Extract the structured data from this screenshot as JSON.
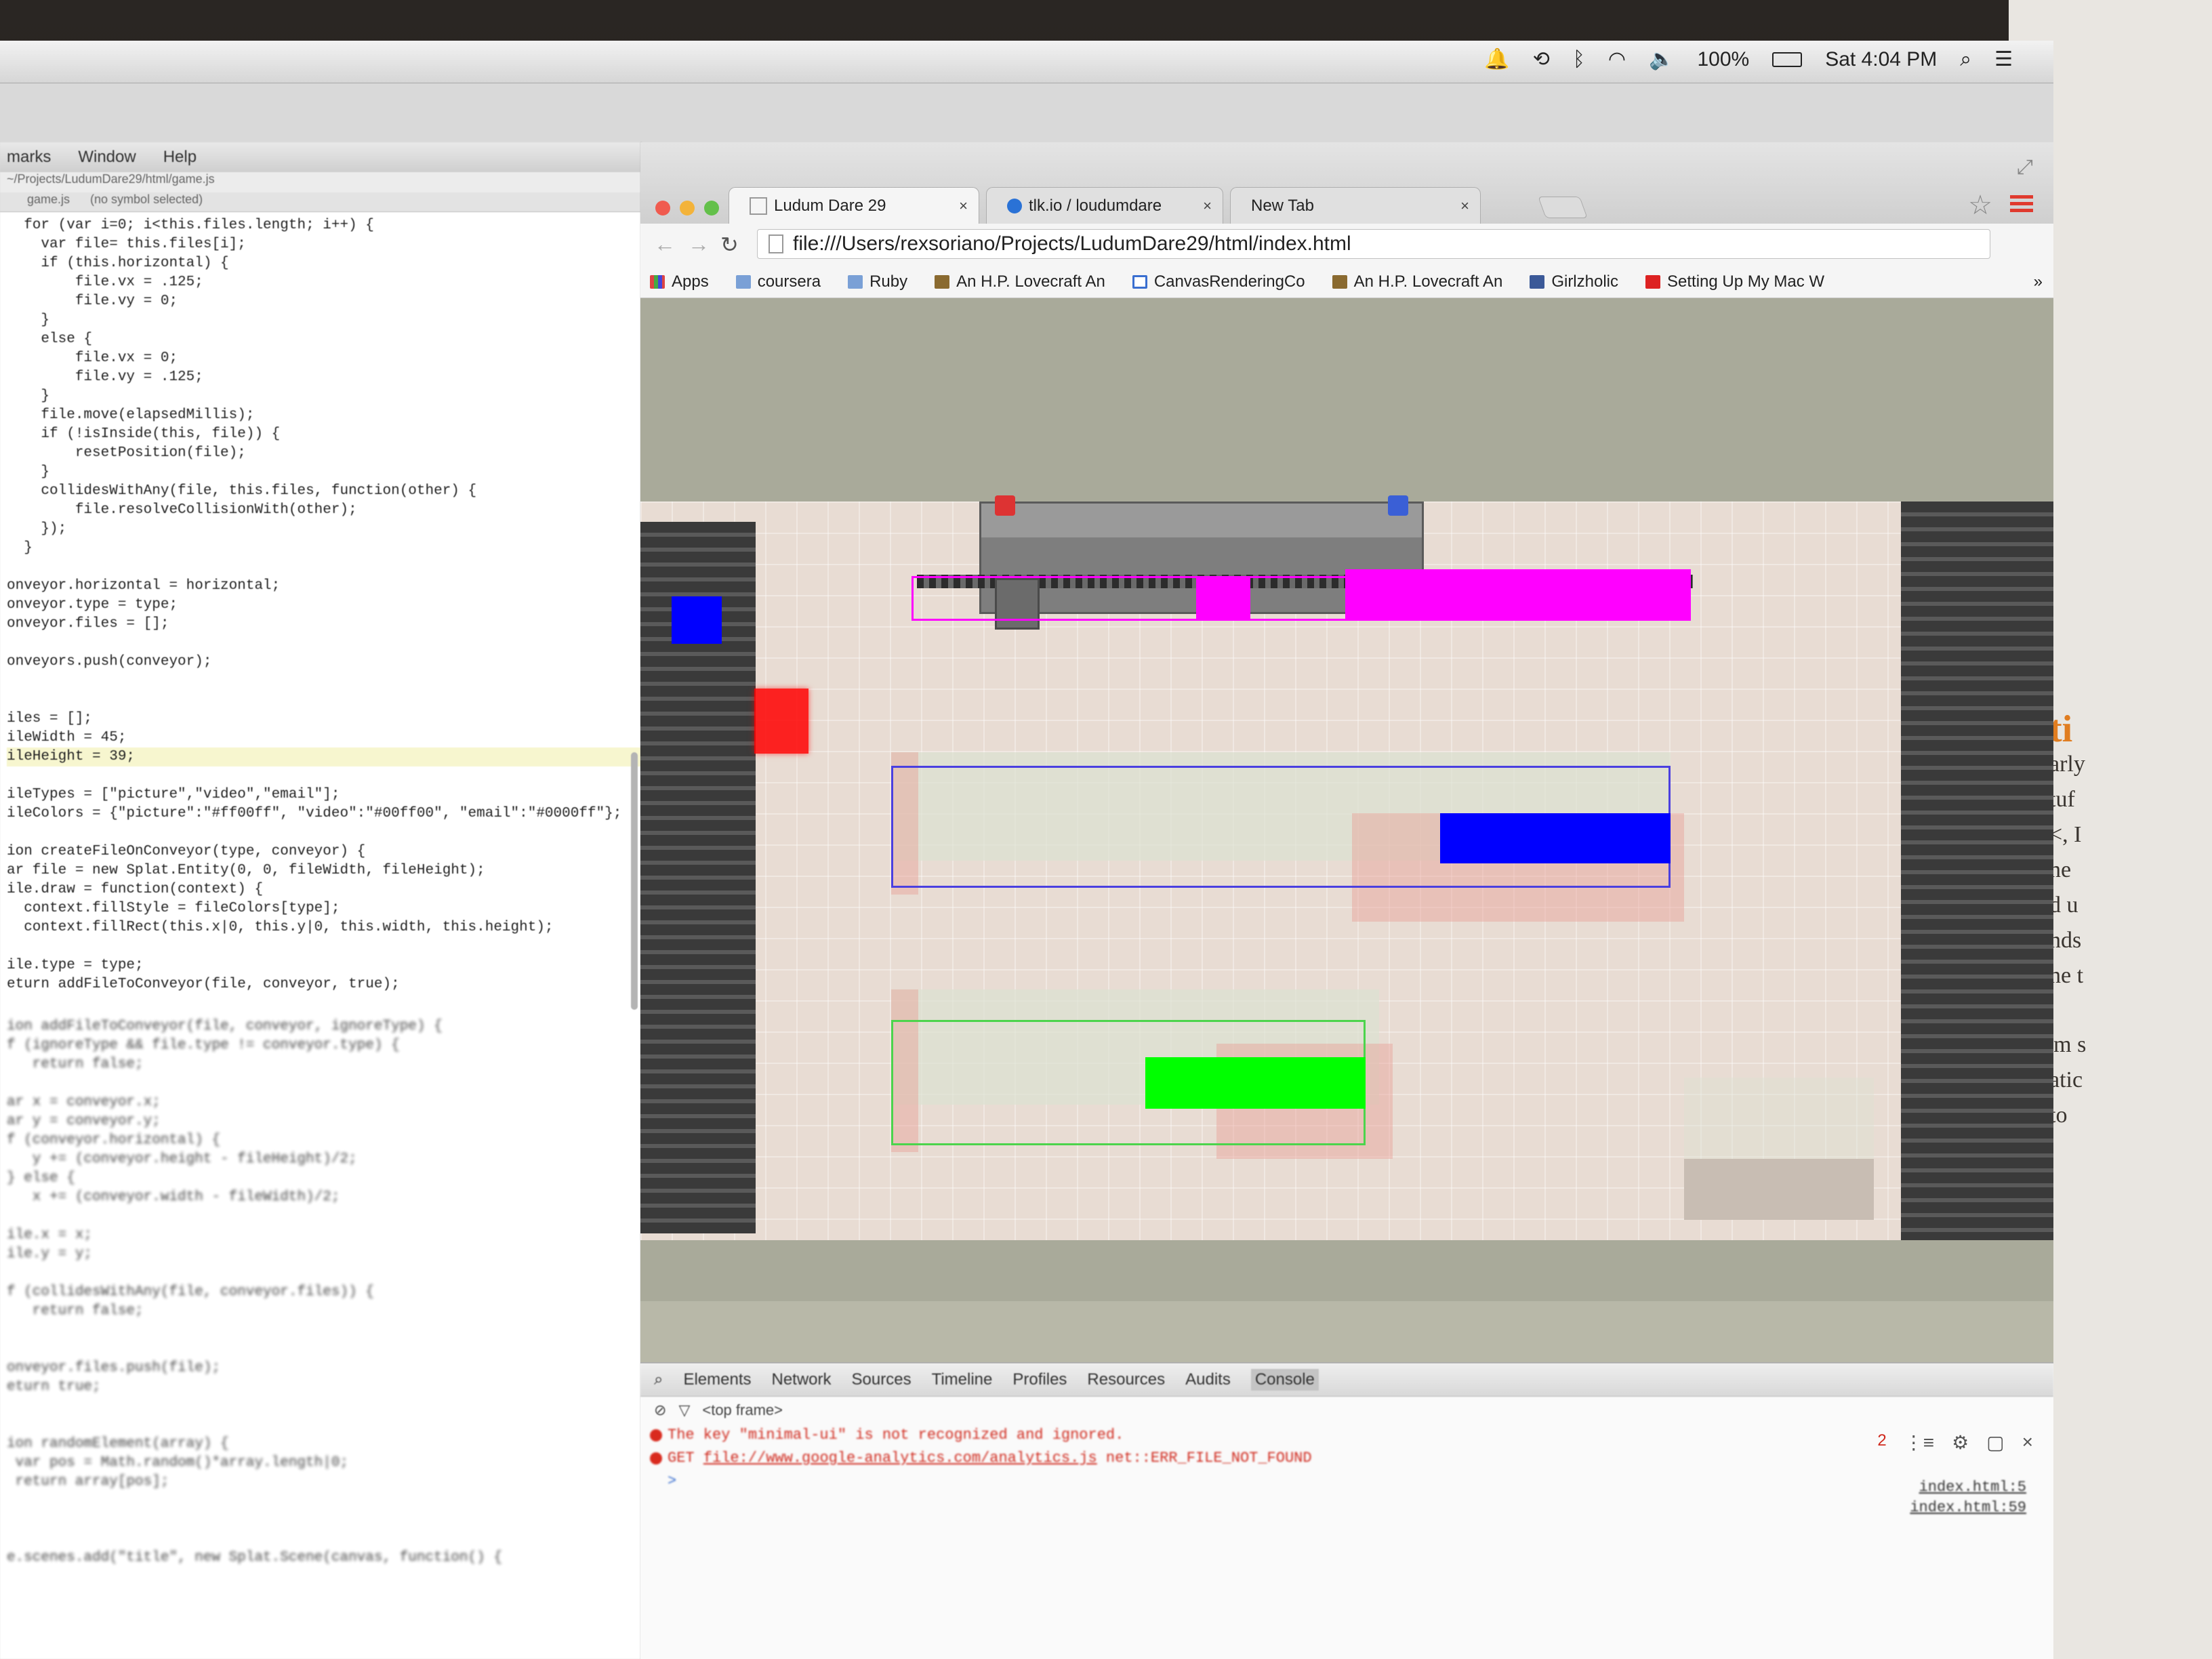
{
  "menubar": {
    "battery": "100%",
    "clock": "Sat 4:04 PM"
  },
  "editor": {
    "menu": [
      "marks",
      "Window",
      "Help"
    ],
    "path": "~/Projects/LudumDare29/html/game.js",
    "tab_file": "game.js",
    "symbol": "(no symbol selected)",
    "code_sharp": [
      "  for (var i=0; i<this.files.length; i++) {",
      "    var file= this.files[i];",
      "    if (this.horizontal) {",
      "        file.vx = .125;",
      "        file.vy = 0;",
      "    }",
      "    else {",
      "        file.vx = 0;",
      "        file.vy = .125;",
      "    }",
      "    file.move(elapsedMillis);",
      "    if (!isInside(this, file)) {",
      "        resetPosition(file);",
      "    }",
      "    collidesWithAny(file, this.files, function(other) {",
      "        file.resolveCollisionWith(other);",
      "    });",
      "  }",
      "",
      "onveyor.horizontal = horizontal;",
      "onveyor.type = type;",
      "onveyor.files = [];",
      "",
      "onveyors.push(conveyor);",
      "",
      "",
      "iles = [];",
      "ileWidth = 45;",
      "ileHeight = 39;",
      "",
      "ileTypes = [\"picture\",\"video\",\"email\"];",
      "ileColors = {\"picture\":\"#ff00ff\", \"video\":\"#00ff00\", \"email\":\"#0000ff\"};",
      "",
      "ion createFileOnConveyor(type, conveyor) {",
      "ar file = new Splat.Entity(0, 0, fileWidth, fileHeight);",
      "ile.draw = function(context) {",
      "  context.fillStyle = fileColors[type];",
      "  context.fillRect(this.x|0, this.y|0, this.width, this.height);",
      "",
      "ile.type = type;",
      "eturn addFileToConveyor(file, conveyor, true);"
    ],
    "code_blur": [
      "",
      "ion addFileToConveyor(file, conveyor, ignoreType) {",
      "f (ignoreType && file.type != conveyor.type) {",
      "   return false;",
      "",
      "ar x = conveyor.x;",
      "ar y = conveyor.y;",
      "f (conveyor.horizontal) {",
      "   y += (conveyor.height - fileHeight)/2;",
      "} else {",
      "   x += (conveyor.width - fileWidth)/2;",
      "",
      "ile.x = x;",
      "ile.y = y;",
      "",
      "f (collidesWithAny(file, conveyor.files)) {",
      "   return false;",
      "",
      "",
      "onveyor.files.push(file);",
      "eturn true;",
      "",
      "",
      "ion randomElement(array) {",
      " var pos = Math.random()*array.length|0;",
      " return array[pos];",
      "",
      "",
      "",
      "e.scenes.add(\"title\", new Splat.Scene(canvas, function() {"
    ]
  },
  "browser": {
    "tabs": [
      {
        "title": "Ludum Dare 29",
        "active": true
      },
      {
        "title": "tlk.io / loudumdare",
        "active": false
      },
      {
        "title": "New Tab",
        "active": false
      }
    ],
    "url": "file:///Users/rexsoriano/Projects/LudumDare29/html/index.html",
    "bookmarks": [
      {
        "label": "Apps",
        "icon": "apps-icon"
      },
      {
        "label": "coursera",
        "icon": "folder-icon"
      },
      {
        "label": "Ruby",
        "icon": "folder-icon"
      },
      {
        "label": "An H.P. Lovecraft An",
        "icon": "book-icon"
      },
      {
        "label": "CanvasRenderingCo",
        "icon": "canvas-icon"
      },
      {
        "label": "An H.P. Lovecraft An",
        "icon": "book-icon"
      },
      {
        "label": "Girlzholic",
        "icon": "facebook-icon"
      },
      {
        "label": "Setting Up My Mac W",
        "icon": "mac-icon"
      }
    ],
    "bookmarks_more": "»"
  },
  "game": {
    "file_colors": {
      "picture": "#ff00ff",
      "video": "#00ff00",
      "email": "#0000ff"
    },
    "lamp_left": "R",
    "lamp_right": "B"
  },
  "devtools": {
    "tabs": [
      "Elements",
      "Network",
      "Sources",
      "Timeline",
      "Profiles",
      "Resources",
      "Audits",
      "Console"
    ],
    "frame": "<top frame>",
    "messages": [
      {
        "text": "The key \"minimal-ui\" is not recognized and ignored.",
        "source": "index.html:5"
      },
      {
        "prefix": "GET",
        "url": "file://www.google-analytics.com/analytics.js",
        "error": "net::ERR_FILE_NOT_FOUND",
        "source": "index.html:59"
      }
    ],
    "error_count": "2",
    "prompt": ">"
  },
  "backdrop": {
    "wall_text": [
      "ti",
      "arly",
      "tuf",
      "<, I",
      "ne",
      "d u",
      "nds",
      "ne t",
      "'m s",
      "atic",
      "to"
    ]
  }
}
